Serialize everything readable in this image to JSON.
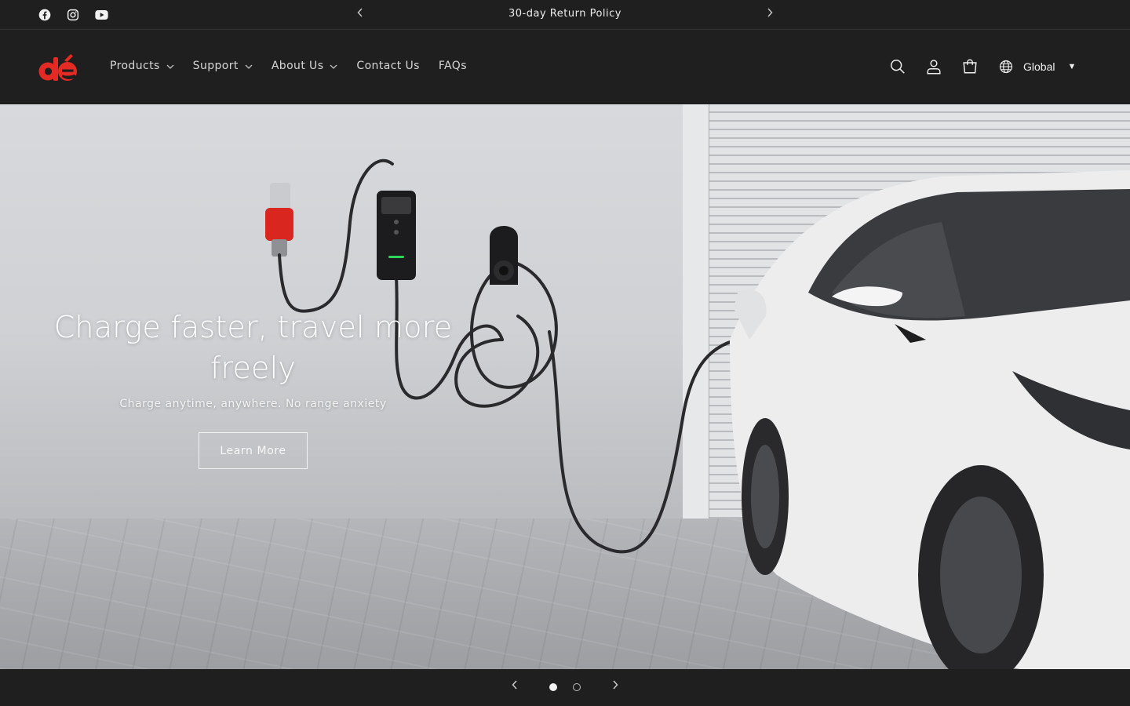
{
  "announcement": {
    "text": "30-day Return Policy",
    "prev_icon": "chevron-left-icon",
    "next_icon": "chevron-right-icon"
  },
  "social": [
    "facebook-icon",
    "instagram-icon",
    "youtube-icon"
  ],
  "header": {
    "brand_colors": {
      "red": "#e42b23"
    },
    "nav": [
      {
        "label": "Products",
        "has_dropdown": true
      },
      {
        "label": "Support",
        "has_dropdown": true
      },
      {
        "label": "About Us",
        "has_dropdown": true
      },
      {
        "label": "Contact Us",
        "has_dropdown": false
      },
      {
        "label": "FAQs",
        "has_dropdown": false
      }
    ],
    "icons": [
      "search-icon",
      "account-icon",
      "cart-icon"
    ],
    "region": {
      "label": "Global",
      "caret": "▼",
      "icon": "globe-icon"
    }
  },
  "hero": {
    "title_line1": "Charge faster, travel more",
    "title_line2": "freely",
    "subtitle": "Charge anytime, anywhere. No range anxiety",
    "button_label": "Learn More"
  },
  "slider": {
    "slide_count": 2,
    "active_index": 0,
    "prev_icon": "chevron-left-icon",
    "next_icon": "chevron-right-icon"
  }
}
